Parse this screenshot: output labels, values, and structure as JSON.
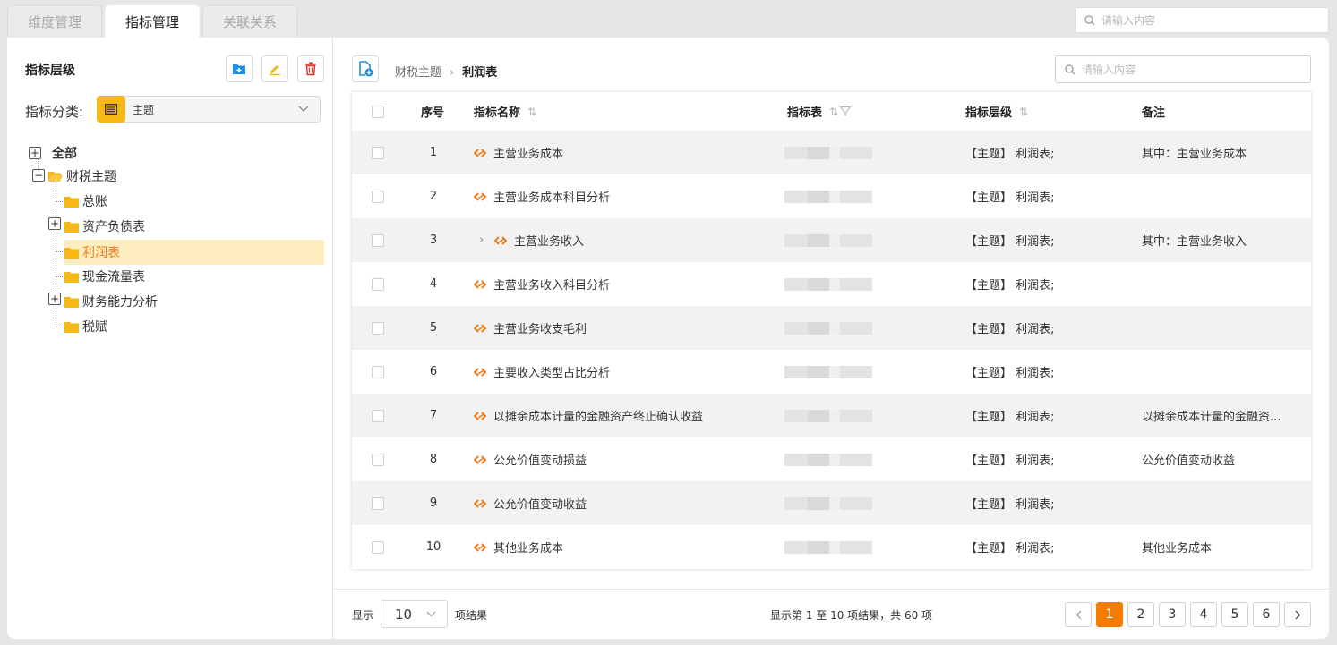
{
  "tabs": [
    {
      "label": "维度管理",
      "active": false
    },
    {
      "label": "指标管理",
      "active": true
    },
    {
      "label": "关联关系",
      "active": false
    }
  ],
  "top_search": {
    "placeholder": "请输入内容",
    "icon": "search-icon"
  },
  "left": {
    "title": "指标层级",
    "toolbar_icons": [
      "folder-add-icon",
      "edit-icon",
      "delete-icon"
    ],
    "category_label": "指标分类:",
    "category_value": "主题",
    "tree": [
      {
        "label": "全部",
        "expander": "plus",
        "bold": true
      },
      {
        "label": "财税主题",
        "expander": "minus",
        "open": true
      },
      {
        "label": "总账",
        "expander": ""
      },
      {
        "label": "资产负债表",
        "expander": "plus"
      },
      {
        "label": "利润表",
        "expander": "",
        "selected": true
      },
      {
        "label": "现金流量表",
        "expander": ""
      },
      {
        "label": "财务能力分析",
        "expander": "plus"
      },
      {
        "label": "税赋",
        "expander": ""
      }
    ]
  },
  "right": {
    "breadcrumb": [
      "财税主题",
      "利润表"
    ],
    "search_placeholder": "请输入内容",
    "columns": [
      "序号",
      "指标名称",
      "指标表",
      "指标层级",
      "备注"
    ],
    "rows": [
      {
        "no": "1",
        "name": "主营业务成本",
        "level": "【主题】 利润表;",
        "note": "其中：主营业务成本"
      },
      {
        "no": "2",
        "name": "主营业务成本科目分析",
        "level": "【主题】 利润表;",
        "note": ""
      },
      {
        "no": "3",
        "name": "主营业务收入",
        "level": "【主题】 利润表;",
        "note": "其中：主营业务收入",
        "expandable": true
      },
      {
        "no": "4",
        "name": "主营业务收入科目分析",
        "level": "【主题】 利润表;",
        "note": ""
      },
      {
        "no": "5",
        "name": "主营业务收支毛利",
        "level": "【主题】 利润表;",
        "note": ""
      },
      {
        "no": "6",
        "name": "主要收入类型占比分析",
        "level": "【主题】 利润表;",
        "note": ""
      },
      {
        "no": "7",
        "name": "以摊余成本计量的金融资产终止确认收益",
        "level": "【主题】 利润表;",
        "note": "以摊余成本计量的金融资..."
      },
      {
        "no": "8",
        "name": "公允价值变动损益",
        "level": "【主题】 利润表;",
        "note": "公允价值变动收益"
      },
      {
        "no": "9",
        "name": "公允价值变动收益",
        "level": "【主题】 利润表;",
        "note": ""
      },
      {
        "no": "10",
        "name": "其他业务成本",
        "level": "【主题】 利润表;",
        "note": "其他业务成本"
      }
    ]
  },
  "footer": {
    "show_label": "显示",
    "page_size": "10",
    "results_label": "项结果",
    "summary": "显示第 1 至 10 项结果，共 60 项",
    "pages": [
      "1",
      "2",
      "3",
      "4",
      "5",
      "6"
    ],
    "current_page": "1",
    "prev_icon": "chevron-left-icon",
    "next_icon": "chevron-right-icon"
  },
  "colors": {
    "accent": "#f57c00",
    "selected_bg": "#fdedbf",
    "folder": "#f6b816",
    "link_icon": "#f07a1a"
  }
}
